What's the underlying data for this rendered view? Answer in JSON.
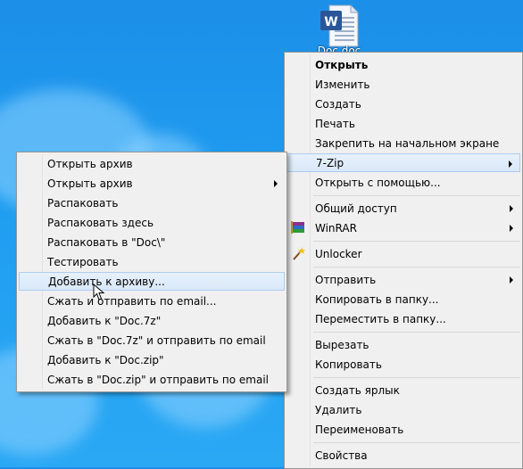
{
  "desktop": {
    "file_caption": "Doc.doc"
  },
  "main_menu": {
    "items": [
      {
        "label": "Открыть"
      },
      {
        "label": "Изменить"
      },
      {
        "label": "Создать"
      },
      {
        "label": "Печать"
      },
      {
        "label": "Закрепить на начальном экране"
      },
      {
        "label": "7-Zip"
      },
      {
        "label": "Открыть с помощью..."
      },
      {
        "label": "Общий доступ"
      },
      {
        "label": "WinRAR"
      },
      {
        "label": "Unlocker"
      },
      {
        "label": "Отправить"
      },
      {
        "label": "Копировать в папку..."
      },
      {
        "label": "Переместить в папку..."
      },
      {
        "label": "Вырезать"
      },
      {
        "label": "Копировать"
      },
      {
        "label": "Создать ярлык"
      },
      {
        "label": "Удалить"
      },
      {
        "label": "Переименовать"
      },
      {
        "label": "Свойства"
      }
    ]
  },
  "zip_submenu": {
    "items": [
      {
        "label": "Открыть архив"
      },
      {
        "label": "Открыть архив"
      },
      {
        "label": "Распаковать"
      },
      {
        "label": "Распаковать здесь"
      },
      {
        "label": "Распаковать в \"Doc\\\""
      },
      {
        "label": "Тестировать"
      },
      {
        "label": "Добавить к архиву..."
      },
      {
        "label": "Сжать и отправить по email..."
      },
      {
        "label": "Добавить к \"Doc.7z\""
      },
      {
        "label": "Сжать в \"Doc.7z\" и отправить по email"
      },
      {
        "label": "Добавить к \"Doc.zip\""
      },
      {
        "label": "Сжать в \"Doc.zip\" и отправить по email"
      }
    ]
  },
  "icons": {
    "file": "word-document-icon",
    "winrar": "winrar-books-icon",
    "unlocker": "magic-wand-icon",
    "submenu": "chevron-right-icon",
    "cursor": "mouse-pointer-icon"
  },
  "colors": {
    "desktop_blue": "#1f9cf0",
    "menu_background": "#f0f0f0",
    "highlight": "#d9e8f8",
    "highlight_border": "#aeccef"
  }
}
